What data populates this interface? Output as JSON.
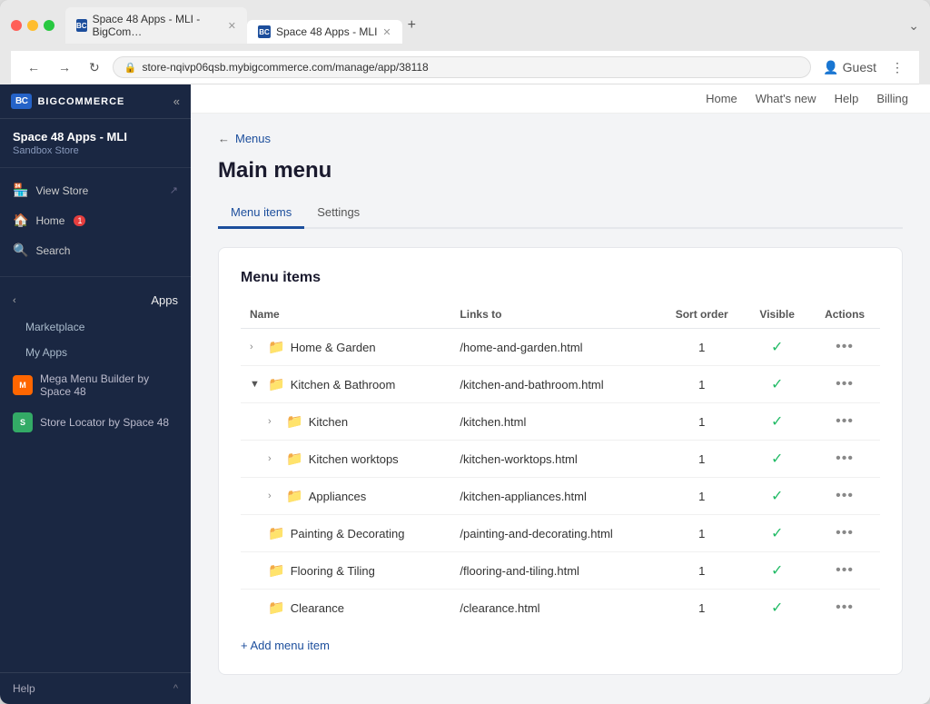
{
  "browser": {
    "tabs": [
      {
        "label": "Space 48 Apps - MLI - BigCom…",
        "active": false,
        "favicon": "BC"
      },
      {
        "label": "Space 48 Apps - MLI",
        "active": true,
        "favicon": "BC"
      }
    ],
    "address": "store-nqivp06qsb.mybigcommerce.com/manage/app/38118",
    "new_tab": "+",
    "nav": {
      "back": "←",
      "forward": "→",
      "refresh": "↻"
    },
    "guest_label": "Guest",
    "more_label": "⋮"
  },
  "top_nav": {
    "links": [
      "Home",
      "What's new",
      "Help",
      "Billing"
    ]
  },
  "sidebar": {
    "logo_text": "BIGCOMMERCE",
    "logo_abbr": "BC",
    "collapse_icon": "«",
    "store_name": "Space 48 Apps - MLI",
    "store_subtitle": "Sandbox Store",
    "nav_items": [
      {
        "icon": "🏪",
        "label": "View Store",
        "ext": true
      },
      {
        "icon": "🏠",
        "label": "Home",
        "badge": "1"
      },
      {
        "icon": "🔍",
        "label": "Search"
      }
    ],
    "apps_section": {
      "label": "Apps",
      "chevron": "‹",
      "sub_items": [
        {
          "label": "Marketplace"
        },
        {
          "label": "My Apps"
        }
      ],
      "installed_apps": [
        {
          "label": "Mega Menu Builder by Space 48",
          "icon": "M"
        },
        {
          "label": "Store Locator by Space 48",
          "icon": "S"
        }
      ]
    },
    "footer": {
      "label": "Help",
      "chevron": "^"
    }
  },
  "page": {
    "breadcrumb_link": "Menus",
    "breadcrumb_back": "←",
    "title": "Main menu",
    "tabs": [
      {
        "label": "Menu items",
        "active": true
      },
      {
        "label": "Settings",
        "active": false
      }
    ],
    "card_title": "Menu items",
    "table": {
      "columns": [
        {
          "label": "Name"
        },
        {
          "label": "Links to"
        },
        {
          "label": "Sort order",
          "align": "center"
        },
        {
          "label": "Visible",
          "align": "center"
        },
        {
          "label": "Actions",
          "align": "center"
        }
      ],
      "rows": [
        {
          "indent": 0,
          "expandable": true,
          "expanded": false,
          "folder": true,
          "name": "Home & Garden",
          "link": "/home-and-garden.html",
          "sort": "1",
          "visible": true
        },
        {
          "indent": 0,
          "expandable": true,
          "expanded": true,
          "folder": true,
          "name": "Kitchen & Bathroom",
          "link": "/kitchen-and-bathroom.html",
          "sort": "1",
          "visible": true
        },
        {
          "indent": 1,
          "expandable": true,
          "expanded": false,
          "folder": true,
          "name": "Kitchen",
          "link": "/kitchen.html",
          "sort": "1",
          "visible": true
        },
        {
          "indent": 1,
          "expandable": true,
          "expanded": false,
          "folder": true,
          "name": "Kitchen worktops",
          "link": "/kitchen-worktops.html",
          "sort": "1",
          "visible": true
        },
        {
          "indent": 1,
          "expandable": true,
          "expanded": false,
          "folder": true,
          "name": "Appliances",
          "link": "/kitchen-appliances.html",
          "sort": "1",
          "visible": true
        },
        {
          "indent": 0,
          "expandable": false,
          "expanded": false,
          "folder": true,
          "name": "Painting & Decorating",
          "link": "/painting-and-decorating.html",
          "sort": "1",
          "visible": true
        },
        {
          "indent": 0,
          "expandable": false,
          "expanded": false,
          "folder": true,
          "name": "Flooring & Tiling",
          "link": "/flooring-and-tiling.html",
          "sort": "1",
          "visible": true
        },
        {
          "indent": 0,
          "expandable": false,
          "expanded": false,
          "folder": true,
          "name": "Clearance",
          "link": "/clearance.html",
          "sort": "1",
          "visible": true
        }
      ],
      "add_label": "+ Add menu item"
    }
  }
}
